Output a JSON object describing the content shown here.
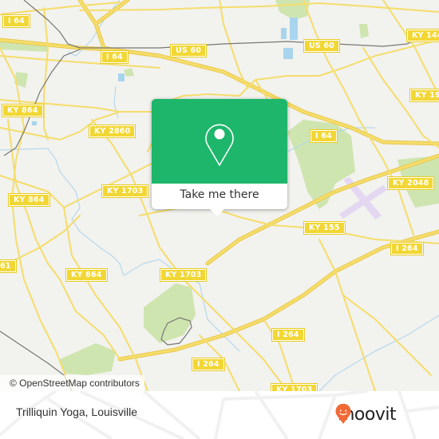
{
  "map": {
    "attribution": "© OpenStreetMap contributors",
    "colors": {
      "background": "#f2f2ee",
      "road": "#f5dd6b",
      "road_casing": "#e8c84a",
      "park": "#cfe5b0",
      "water": "#a9d4ee",
      "airport": "#e3d7f2",
      "rail": "#777777",
      "shield": "#f2d734"
    },
    "road_labels": [
      {
        "id": "i64-nw",
        "text": "I 64"
      },
      {
        "id": "i64-center",
        "text": "I 64"
      },
      {
        "id": "us60-top",
        "text": "US 60"
      },
      {
        "id": "us60-right",
        "text": "US 60"
      },
      {
        "id": "ky144",
        "text": "KY 144"
      },
      {
        "id": "ky19",
        "text": "KY 19"
      },
      {
        "id": "ky864-n",
        "text": "KY 864"
      },
      {
        "id": "ky2860",
        "text": "KY 2860"
      },
      {
        "id": "i64-east",
        "text": "I 64"
      },
      {
        "id": "ky864-w",
        "text": "KY 864"
      },
      {
        "id": "ky1703-w",
        "text": "KY 1703"
      },
      {
        "id": "ky2048",
        "text": "KY 2048"
      },
      {
        "id": "ky155",
        "text": "KY 155"
      },
      {
        "id": "i264-e",
        "text": "I 264"
      },
      {
        "id": "ky61",
        "text": "61"
      },
      {
        "id": "ky864-s",
        "text": "KY 864"
      },
      {
        "id": "ky1703-s",
        "text": "KY 1703"
      },
      {
        "id": "i264-s",
        "text": "I 264"
      },
      {
        "id": "i264-sw",
        "text": "I 264"
      },
      {
        "id": "ky1703-bottom",
        "text": "KY 1703"
      }
    ]
  },
  "popup": {
    "icon": "map-pin-icon",
    "button_label": "Take me there",
    "color": "#1db66a"
  },
  "footer": {
    "place_name": "Trilliquin Yoga, Louisville",
    "brand": "moovit",
    "brand_icon": "moovit-smile-pin-icon",
    "brand_color": "#f26a36"
  }
}
